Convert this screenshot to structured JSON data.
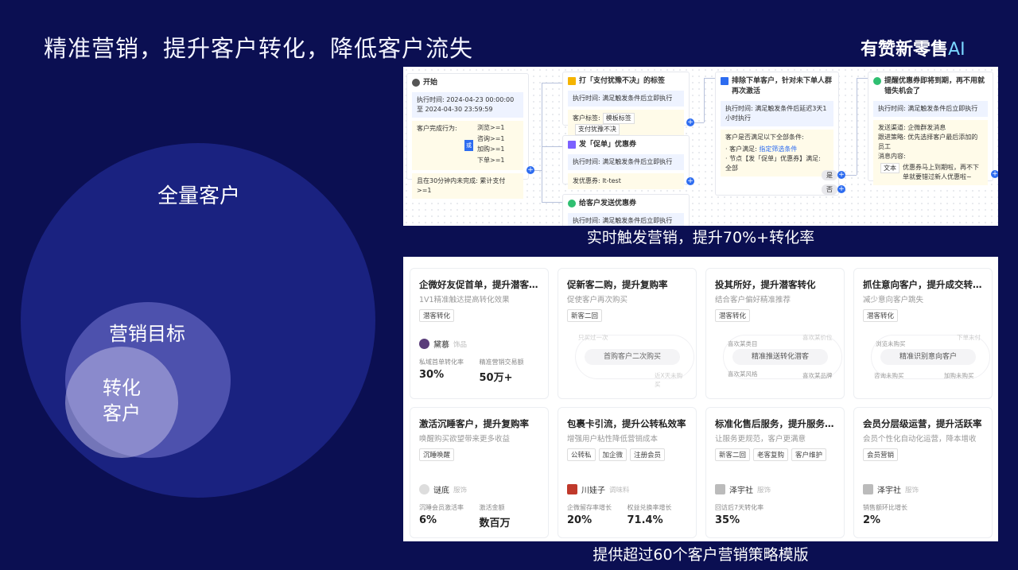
{
  "title": "精准营销，提升客户转化，降低客户流失",
  "logo": {
    "main": "有赞新零售",
    "ai": "AI"
  },
  "circles": {
    "outer": "全量客户",
    "middle": "营销目标",
    "inner_l1": "转化",
    "inner_l2": "客户"
  },
  "captions": {
    "realtime": "实时触发营销，提升70%+转化率",
    "templates": "提供超过60个客户营销策略模版"
  },
  "flow": {
    "start": {
      "title": "开始",
      "exec_time": "执行时间: 2024-04-23 00:00:00 至 2024-04-30 23:59:59",
      "cond_label": "客户完成行为:",
      "or": "或",
      "conds": [
        "浏览>=1",
        "咨询>=1",
        "加购>=1",
        "下单>=1"
      ],
      "unpaid": "且在30分钟内未完成: 累计支付>=1"
    },
    "tag_node": {
      "title": "打「支付犹豫不决」的标签",
      "exec": "执行时间: 满足触发条件后立即执行",
      "tag_label": "客户标签:",
      "tag_template": "模板标签",
      "tag_value": "支付犹豫不决"
    },
    "coupon_node": {
      "title": "发「促单」优惠券",
      "exec": "执行时间: 满足触发条件后立即执行",
      "coupon": "发优惠券: lt-test"
    },
    "send_node": {
      "title": "给客户发送优惠券",
      "exec": "执行时间: 满足触发条件后立即执行"
    },
    "filter_node": {
      "title": "排除下单客户，针对未下单人群再次激活",
      "exec": "执行时间: 满足触发条件后延迟3天1小时执行",
      "q": "客户是否满足以下全部条件:",
      "c1a": "客户满足:",
      "c1b": "指定筛选条件",
      "c2": "节点【发「促单」优惠券】满足: 全部",
      "yes": "是",
      "no": "否"
    },
    "remind_node": {
      "title": "提醒优惠券即将到期，再不用就错失机会了",
      "exec": "执行时间: 满足触发条件后立即执行",
      "channel": "发送渠道: 企微群发消息",
      "strategy": "跟进策略: 优先选择客户最后添加的员工",
      "content_label": "消息内容:",
      "text_tag": "文本",
      "text": "优惠券马上到期啦，再不下单就要错过新人优惠啦~"
    }
  },
  "cards": [
    {
      "title": "企微好友促首单，提升潜客…",
      "sub": "1V1精准触达提高转化效果",
      "tags": [
        "潜客转化"
      ],
      "flow": [
        "只买过一次",
        "首购客户二次购买",
        "近X天未购买"
      ],
      "brand": "黛慕",
      "brand_sub": "饰品",
      "m1l": "私域首单转化率",
      "m1v": "30%",
      "m2l": "精准营销交易额",
      "m2v": "50万+"
    },
    {
      "title": "促新客二购，提升复购率",
      "sub": "促使客户再次购买",
      "tags": [
        "新客二回"
      ],
      "flow": [
        "",
        "",
        ""
      ],
      "brand": "",
      "brand_sub": "",
      "m1l": "",
      "m1v": "",
      "m2l": "",
      "m2v": ""
    },
    {
      "title": "投其所好，提升潜客转化",
      "sub": "结合客户偏好精准推荐",
      "tags": [
        "潜客转化"
      ],
      "flow": [
        "喜欢某类目",
        "精准推送转化潜客",
        "喜欢某品牌",
        "喜欢某风格",
        "喜欢某价位"
      ],
      "brand": "",
      "brand_sub": "",
      "m1l": "",
      "m1v": "",
      "m2l": "",
      "m2v": ""
    },
    {
      "title": "抓住意向客户，提升成交转…",
      "sub": "减少意向客户跳失",
      "tags": [
        "潜客转化"
      ],
      "flow": [
        "浏览未购买",
        "精准识别意向客户",
        "咨询未购买",
        "加购未购买",
        "下单未付"
      ],
      "brand": "",
      "brand_sub": "",
      "m1l": "",
      "m1v": "",
      "m2l": "",
      "m2v": ""
    },
    {
      "title": "激活沉睡客户，提升复购率",
      "sub": "唤醒购买欲望带来更多收益",
      "tags": [
        "沉睡唤醒"
      ],
      "flow": [],
      "brand": "谜底",
      "brand_sub": "服饰",
      "m1l": "沉睡会员激活率",
      "m1v": "6%",
      "m2l": "激活金额",
      "m2v": "数百万"
    },
    {
      "title": "包裹卡引流，提升公转私效率",
      "sub": "增强用户粘性降低营销成本",
      "tags": [
        "公转私",
        "加企微",
        "注册会员"
      ],
      "flow": [],
      "brand": "川娃子",
      "brand_sub": "调味料",
      "m1l": "企微留存率增长",
      "m1v": "20%",
      "m2l": "权益兑换率增长",
      "m2v": "71.4%"
    },
    {
      "title": "标准化售后服务，提升服务…",
      "sub": "让服务更规范，客户更满意",
      "tags": [
        "新客二回",
        "老客复购",
        "客户维护"
      ],
      "flow": [],
      "brand": "泽宇社",
      "brand_sub": "服饰",
      "m1l": "回访后7天转化率",
      "m1v": "35%",
      "m2l": "",
      "m2v": ""
    },
    {
      "title": "会员分层级运营，提升活跃率",
      "sub": "会员个性化自动化运营，降本增收",
      "tags": [
        "会员营销"
      ],
      "flow": [],
      "brand": "泽宇社",
      "brand_sub": "服饰",
      "m1l": "销售额环比增长",
      "m1v": "2%",
      "m2l": "",
      "m2v": ""
    }
  ],
  "card2_flow": {
    "a": "只买过一次",
    "b": "首购客户二次购买",
    "c": "近X天未购买"
  }
}
